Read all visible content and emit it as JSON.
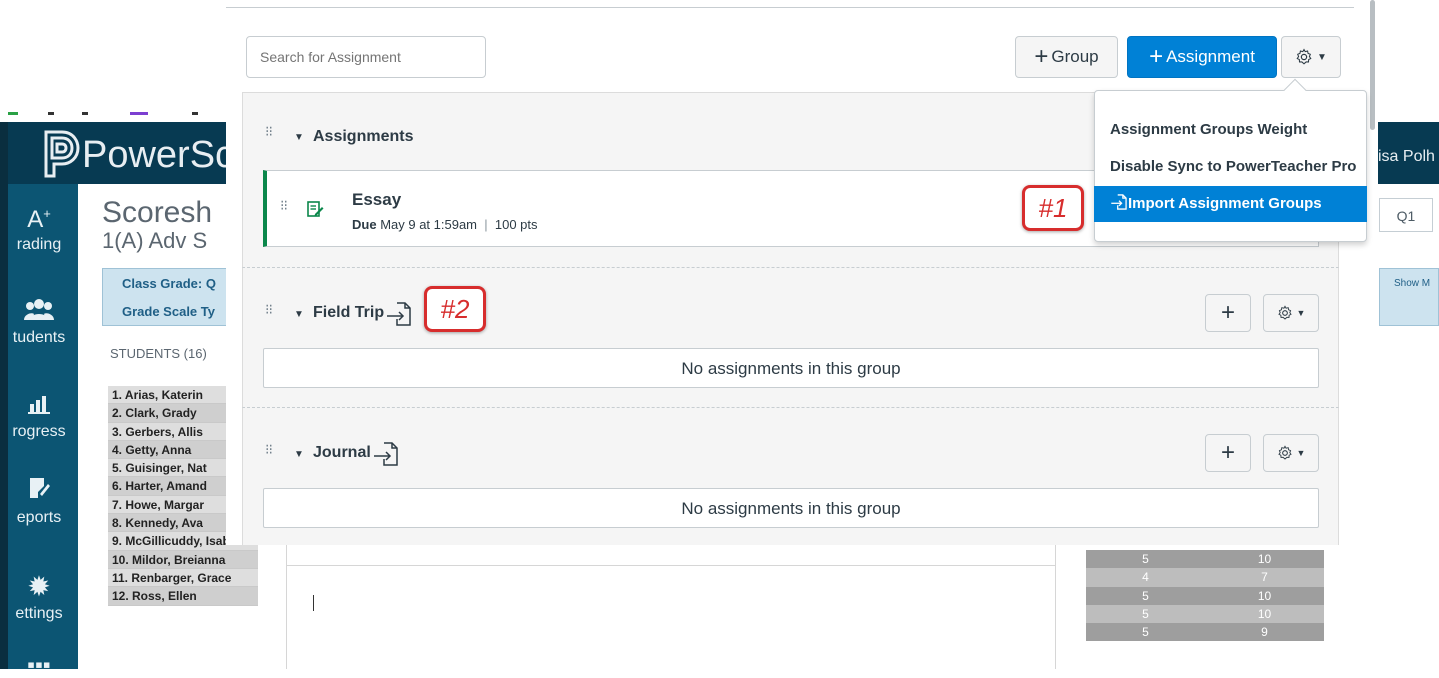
{
  "powerschool": {
    "brand": "PowerSch",
    "user_fragment": "isa Polh",
    "title": "Scoresh",
    "subtitle": "1(A) Adv S",
    "class_grade_label": "Class Grade: Q",
    "grade_scale_label": "Grade Scale Ty",
    "students_label": "STUDENTS (16)",
    "term": "Q1",
    "show_more": "Show M",
    "nav": [
      {
        "label": "Grading",
        "icon": "A+"
      },
      {
        "label": "tudents",
        "icon": "students-icon"
      },
      {
        "label": "rogress",
        "icon": "chart-icon"
      },
      {
        "label": "eports",
        "icon": "reports-icon"
      },
      {
        "label": "ettings",
        "icon": "gear-icon"
      }
    ],
    "nav_grading_label": "rading",
    "students": [
      "1. Arias, Katerin",
      "2. Clark, Grady",
      "3. Gerbers, Allis",
      "4. Getty, Anna",
      "5. Guisinger, Nat",
      "6. Harter, Amand",
      "7. Howe, Margar",
      "8. Kennedy, Ava",
      "9. McGillicuddy, Isab",
      "10. Mildor, Breianna",
      "11. Renbarger, Grace",
      "12. Ross, Ellen"
    ],
    "grade_rows": [
      [
        "5",
        "10"
      ],
      [
        "4",
        "7"
      ],
      [
        "5",
        "10"
      ],
      [
        "5",
        "10"
      ],
      [
        "5",
        "9"
      ]
    ]
  },
  "canvas": {
    "search_placeholder": "Search for Assignment",
    "group_button": "Group",
    "assignment_button": "Assignment",
    "groups": [
      {
        "title": "Assignments"
      },
      {
        "title": "Field Trip",
        "empty_text": "No assignments in this group"
      },
      {
        "title": "Journal",
        "empty_text": "No assignments in this group"
      }
    ],
    "assignment": {
      "title": "Essay",
      "due_label": "Due",
      "due_date": "May 9 at 1:59am",
      "points": "100 pts"
    },
    "menu": [
      "Assignment Groups Weight",
      "Disable Sync to PowerTeacher Pro",
      "Import Assignment Groups"
    ],
    "callouts": [
      "#1",
      "#2"
    ]
  },
  "colors": {
    "accent_blue": "#0081d6",
    "callout_red": "#d72d2d",
    "published_green": "#0b874b",
    "ps_header": "#073a52",
    "ps_nav": "#0c5573"
  }
}
